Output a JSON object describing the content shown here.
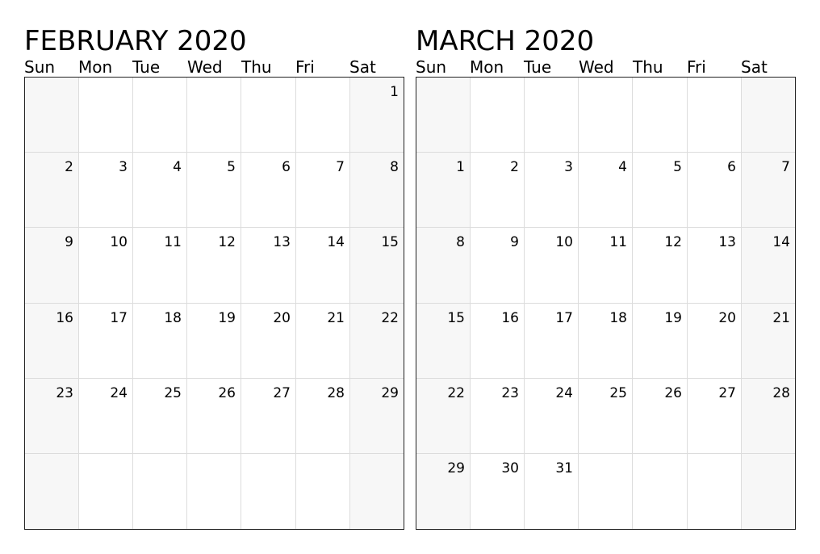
{
  "weekdays": [
    "Sun",
    "Mon",
    "Tue",
    "Wed",
    "Thu",
    "Fri",
    "Sat"
  ],
  "colors": {
    "weekend_fill": "#f7f7f7",
    "grid_line": "#dcdcdc",
    "border": "#222222"
  },
  "months": [
    {
      "title": "FEBRUARY 2020",
      "weeks": [
        [
          "",
          "",
          "",
          "",
          "",
          "",
          "1"
        ],
        [
          "2",
          "3",
          "4",
          "5",
          "6",
          "7",
          "8"
        ],
        [
          "9",
          "10",
          "11",
          "12",
          "13",
          "14",
          "15"
        ],
        [
          "16",
          "17",
          "18",
          "19",
          "20",
          "21",
          "22"
        ],
        [
          "23",
          "24",
          "25",
          "26",
          "27",
          "28",
          "29"
        ],
        [
          "",
          "",
          "",
          "",
          "",
          "",
          ""
        ]
      ]
    },
    {
      "title": "MARCH 2020",
      "weeks": [
        [
          "",
          "",
          "",
          "",
          "",
          "",
          ""
        ],
        [
          "1",
          "2",
          "3",
          "4",
          "5",
          "6",
          "7"
        ],
        [
          "8",
          "9",
          "10",
          "11",
          "12",
          "13",
          "14"
        ],
        [
          "15",
          "16",
          "17",
          "18",
          "19",
          "20",
          "21"
        ],
        [
          "22",
          "23",
          "24",
          "25",
          "26",
          "27",
          "28"
        ],
        [
          "29",
          "30",
          "31",
          "",
          "",
          "",
          ""
        ]
      ]
    }
  ]
}
